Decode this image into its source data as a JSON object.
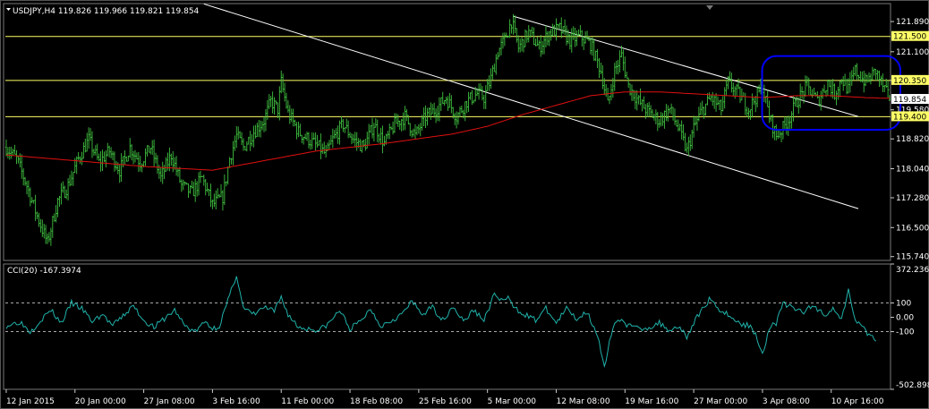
{
  "header": {
    "symbol_line": "USDJPY,H4  119.826 119.966 119.821 119.854",
    "cci_label": "CCI(20) -167.3974"
  },
  "colors": {
    "background": "#000000",
    "bars": "#3fbf3f",
    "moving_average": "#e01010",
    "levels": "#ffff66",
    "channel": "#ffffff",
    "cci": "#20b2aa",
    "highlight": "#0000ff",
    "level_tag": "#ffff66",
    "current_tag": "#ffffff"
  },
  "chart_data": [
    {
      "type": "bar",
      "subtype": "ohlc",
      "symbol": "USDJPY",
      "timeframe": "H4",
      "ohlc_last": {
        "open": 119.826,
        "high": 119.966,
        "low": 119.821,
        "close": 119.854
      },
      "y_ticks": [
        121.89,
        121.1,
        120.35,
        119.58,
        118.82,
        118.04,
        117.28,
        116.5,
        115.74
      ],
      "ylim": [
        115.64,
        122.36
      ],
      "x_ticks": [
        "12 Jan 2015",
        "20 Jan 00:00",
        "27 Jan 08:00",
        "3 Feb 16:00",
        "11 Feb 00:00",
        "18 Feb 08:00",
        "25 Feb 16:00",
        "5 Mar 00:00",
        "12 Mar 08:00",
        "19 Mar 16:00",
        "27 Mar 00:00",
        "3 Apr 08:00",
        "10 Apr 16:00"
      ],
      "x_tick_index": [
        0,
        40,
        80,
        120,
        160,
        200,
        240,
        280,
        320,
        360,
        400,
        440,
        480
      ],
      "bar_count": 515,
      "closes_keypoints": [
        [
          0,
          118.6
        ],
        [
          6,
          118.3
        ],
        [
          12,
          117.6
        ],
        [
          18,
          116.8
        ],
        [
          24,
          116.1
        ],
        [
          30,
          117.2
        ],
        [
          36,
          117.6
        ],
        [
          42,
          118.3
        ],
        [
          48,
          118.8
        ],
        [
          54,
          118.2
        ],
        [
          60,
          118.5
        ],
        [
          66,
          118.0
        ],
        [
          72,
          118.6
        ],
        [
          78,
          118.2
        ],
        [
          84,
          118.6
        ],
        [
          90,
          117.8
        ],
        [
          96,
          118.4
        ],
        [
          102,
          117.6
        ],
        [
          108,
          117.4
        ],
        [
          114,
          117.8
        ],
        [
          120,
          117.1
        ],
        [
          126,
          117.3
        ],
        [
          130,
          118.3
        ],
        [
          134,
          118.9
        ],
        [
          138,
          118.6
        ],
        [
          144,
          119.0
        ],
        [
          150,
          119.3
        ],
        [
          154,
          119.8
        ],
        [
          158,
          119.6
        ],
        [
          160,
          120.3
        ],
        [
          164,
          119.5
        ],
        [
          170,
          119.0
        ],
        [
          176,
          118.8
        ],
        [
          182,
          118.6
        ],
        [
          186,
          118.4
        ],
        [
          190,
          118.8
        ],
        [
          196,
          119.2
        ],
        [
          202,
          118.8
        ],
        [
          208,
          118.6
        ],
        [
          214,
          119.2
        ],
        [
          220,
          118.7
        ],
        [
          226,
          119.2
        ],
        [
          232,
          119.4
        ],
        [
          238,
          118.9
        ],
        [
          244,
          119.4
        ],
        [
          250,
          119.6
        ],
        [
          256,
          119.9
        ],
        [
          262,
          119.4
        ],
        [
          268,
          119.8
        ],
        [
          274,
          120.0
        ],
        [
          278,
          119.9
        ],
        [
          282,
          120.4
        ],
        [
          286,
          121.1
        ],
        [
          290,
          121.4
        ],
        [
          294,
          121.9
        ],
        [
          298,
          121.2
        ],
        [
          304,
          121.6
        ],
        [
          310,
          121.2
        ],
        [
          316,
          121.6
        ],
        [
          322,
          121.7
        ],
        [
          328,
          121.4
        ],
        [
          334,
          121.5
        ],
        [
          340,
          121.3
        ],
        [
          346,
          120.6
        ],
        [
          350,
          119.7
        ],
        [
          354,
          120.6
        ],
        [
          358,
          121.0
        ],
        [
          362,
          120.2
        ],
        [
          368,
          119.8
        ],
        [
          374,
          119.5
        ],
        [
          380,
          119.3
        ],
        [
          386,
          119.6
        ],
        [
          392,
          119.0
        ],
        [
          396,
          118.5
        ],
        [
          400,
          119.1
        ],
        [
          404,
          119.5
        ],
        [
          410,
          119.9
        ],
        [
          416,
          119.6
        ],
        [
          420,
          120.3
        ],
        [
          426,
          120.0
        ],
        [
          432,
          119.6
        ],
        [
          436,
          119.9
        ],
        [
          440,
          120.2
        ],
        [
          444,
          119.4
        ],
        [
          448,
          118.9
        ],
        [
          452,
          119.1
        ],
        [
          456,
          119.4
        ],
        [
          460,
          119.8
        ],
        [
          466,
          120.2
        ],
        [
          472,
          119.8
        ],
        [
          478,
          120.3
        ],
        [
          482,
          120.0
        ],
        [
          486,
          120.4
        ],
        [
          490,
          120.1
        ],
        [
          494,
          120.6
        ],
        [
          500,
          120.3
        ],
        [
          506,
          120.6
        ],
        [
          510,
          120.2
        ],
        [
          514,
          119.85
        ]
      ],
      "ma_keypoints": [
        [
          0,
          118.4
        ],
        [
          40,
          118.25
        ],
        [
          80,
          118.1
        ],
        [
          120,
          118.0
        ],
        [
          150,
          118.25
        ],
        [
          180,
          118.5
        ],
        [
          220,
          118.7
        ],
        [
          260,
          118.95
        ],
        [
          280,
          119.15
        ],
        [
          300,
          119.45
        ],
        [
          320,
          119.7
        ],
        [
          340,
          119.95
        ],
        [
          360,
          120.05
        ],
        [
          380,
          120.05
        ],
        [
          400,
          120.0
        ],
        [
          420,
          119.95
        ],
        [
          440,
          119.9
        ],
        [
          460,
          119.95
        ],
        [
          480,
          119.95
        ],
        [
          500,
          119.9
        ],
        [
          514,
          119.88
        ]
      ],
      "horizontal_levels": [
        121.5,
        120.35,
        119.4
      ],
      "level_labels": [
        "121.500",
        "120.350",
        "119.400"
      ],
      "current_price_label": "119.854",
      "trend_lines": [
        {
          "from": [
            115,
            122.35
          ],
          "to": [
            585,
            115.74
          ]
        },
        {
          "from": [
            295,
            122.03
          ],
          "to": [
            600,
            118.04
          ]
        }
      ],
      "highlight_box": {
        "from_index": 445,
        "to_index": 515,
        "high": 120.8,
        "low": 119.2
      }
    },
    {
      "type": "line",
      "indicator": "CCI(20)",
      "last_value": -167.3974,
      "y_ticks_labels": [
        "372.2363",
        "100",
        "0.00",
        "-100",
        "-502.8983"
      ],
      "y_ticks_values": [
        372.2363,
        100,
        0,
        -100,
        -502.8983
      ],
      "ylim": [
        -502.8983,
        372.2363
      ],
      "dashed_levels": [
        100,
        -100
      ],
      "keypoints": [
        [
          0,
          -60
        ],
        [
          8,
          -30
        ],
        [
          14,
          -100
        ],
        [
          20,
          -20
        ],
        [
          26,
          50
        ],
        [
          32,
          -40
        ],
        [
          38,
          100
        ],
        [
          44,
          60
        ],
        [
          50,
          -30
        ],
        [
          56,
          20
        ],
        [
          62,
          -60
        ],
        [
          68,
          10
        ],
        [
          74,
          80
        ],
        [
          80,
          -20
        ],
        [
          86,
          -70
        ],
        [
          92,
          -10
        ],
        [
          98,
          50
        ],
        [
          104,
          -60
        ],
        [
          110,
          -100
        ],
        [
          116,
          -30
        ],
        [
          120,
          -80
        ],
        [
          124,
          -60
        ],
        [
          130,
          150
        ],
        [
          134,
          300
        ],
        [
          138,
          60
        ],
        [
          144,
          20
        ],
        [
          150,
          70
        ],
        [
          156,
          40
        ],
        [
          160,
          140
        ],
        [
          164,
          20
        ],
        [
          170,
          -70
        ],
        [
          176,
          -80
        ],
        [
          182,
          -90
        ],
        [
          188,
          -40
        ],
        [
          194,
          50
        ],
        [
          200,
          -80
        ],
        [
          206,
          -30
        ],
        [
          212,
          60
        ],
        [
          218,
          -60
        ],
        [
          224,
          -20
        ],
        [
          230,
          20
        ],
        [
          236,
          110
        ],
        [
          242,
          20
        ],
        [
          248,
          70
        ],
        [
          254,
          -20
        ],
        [
          260,
          80
        ],
        [
          266,
          -30
        ],
        [
          272,
          50
        ],
        [
          278,
          -20
        ],
        [
          284,
          160
        ],
        [
          288,
          120
        ],
        [
          292,
          130
        ],
        [
          296,
          60
        ],
        [
          302,
          20
        ],
        [
          308,
          -20
        ],
        [
          314,
          60
        ],
        [
          320,
          -40
        ],
        [
          326,
          60
        ],
        [
          332,
          -10
        ],
        [
          338,
          40
        ],
        [
          344,
          -120
        ],
        [
          348,
          -360
        ],
        [
          352,
          -120
        ],
        [
          356,
          0
        ],
        [
          362,
          -60
        ],
        [
          368,
          -80
        ],
        [
          374,
          -70
        ],
        [
          380,
          -40
        ],
        [
          386,
          -90
        ],
        [
          392,
          -60
        ],
        [
          396,
          -140
        ],
        [
          400,
          -40
        ],
        [
          404,
          40
        ],
        [
          410,
          140
        ],
        [
          414,
          60
        ],
        [
          420,
          20
        ],
        [
          426,
          -40
        ],
        [
          432,
          -60
        ],
        [
          436,
          -110
        ],
        [
          440,
          -260
        ],
        [
          444,
          -70
        ],
        [
          448,
          -40
        ],
        [
          452,
          100
        ],
        [
          458,
          60
        ],
        [
          464,
          40
        ],
        [
          470,
          80
        ],
        [
          476,
          20
        ],
        [
          482,
          60
        ],
        [
          486,
          -20
        ],
        [
          490,
          200
        ],
        [
          494,
          -10
        ],
        [
          500,
          -100
        ],
        [
          506,
          -167.3974
        ]
      ]
    }
  ]
}
